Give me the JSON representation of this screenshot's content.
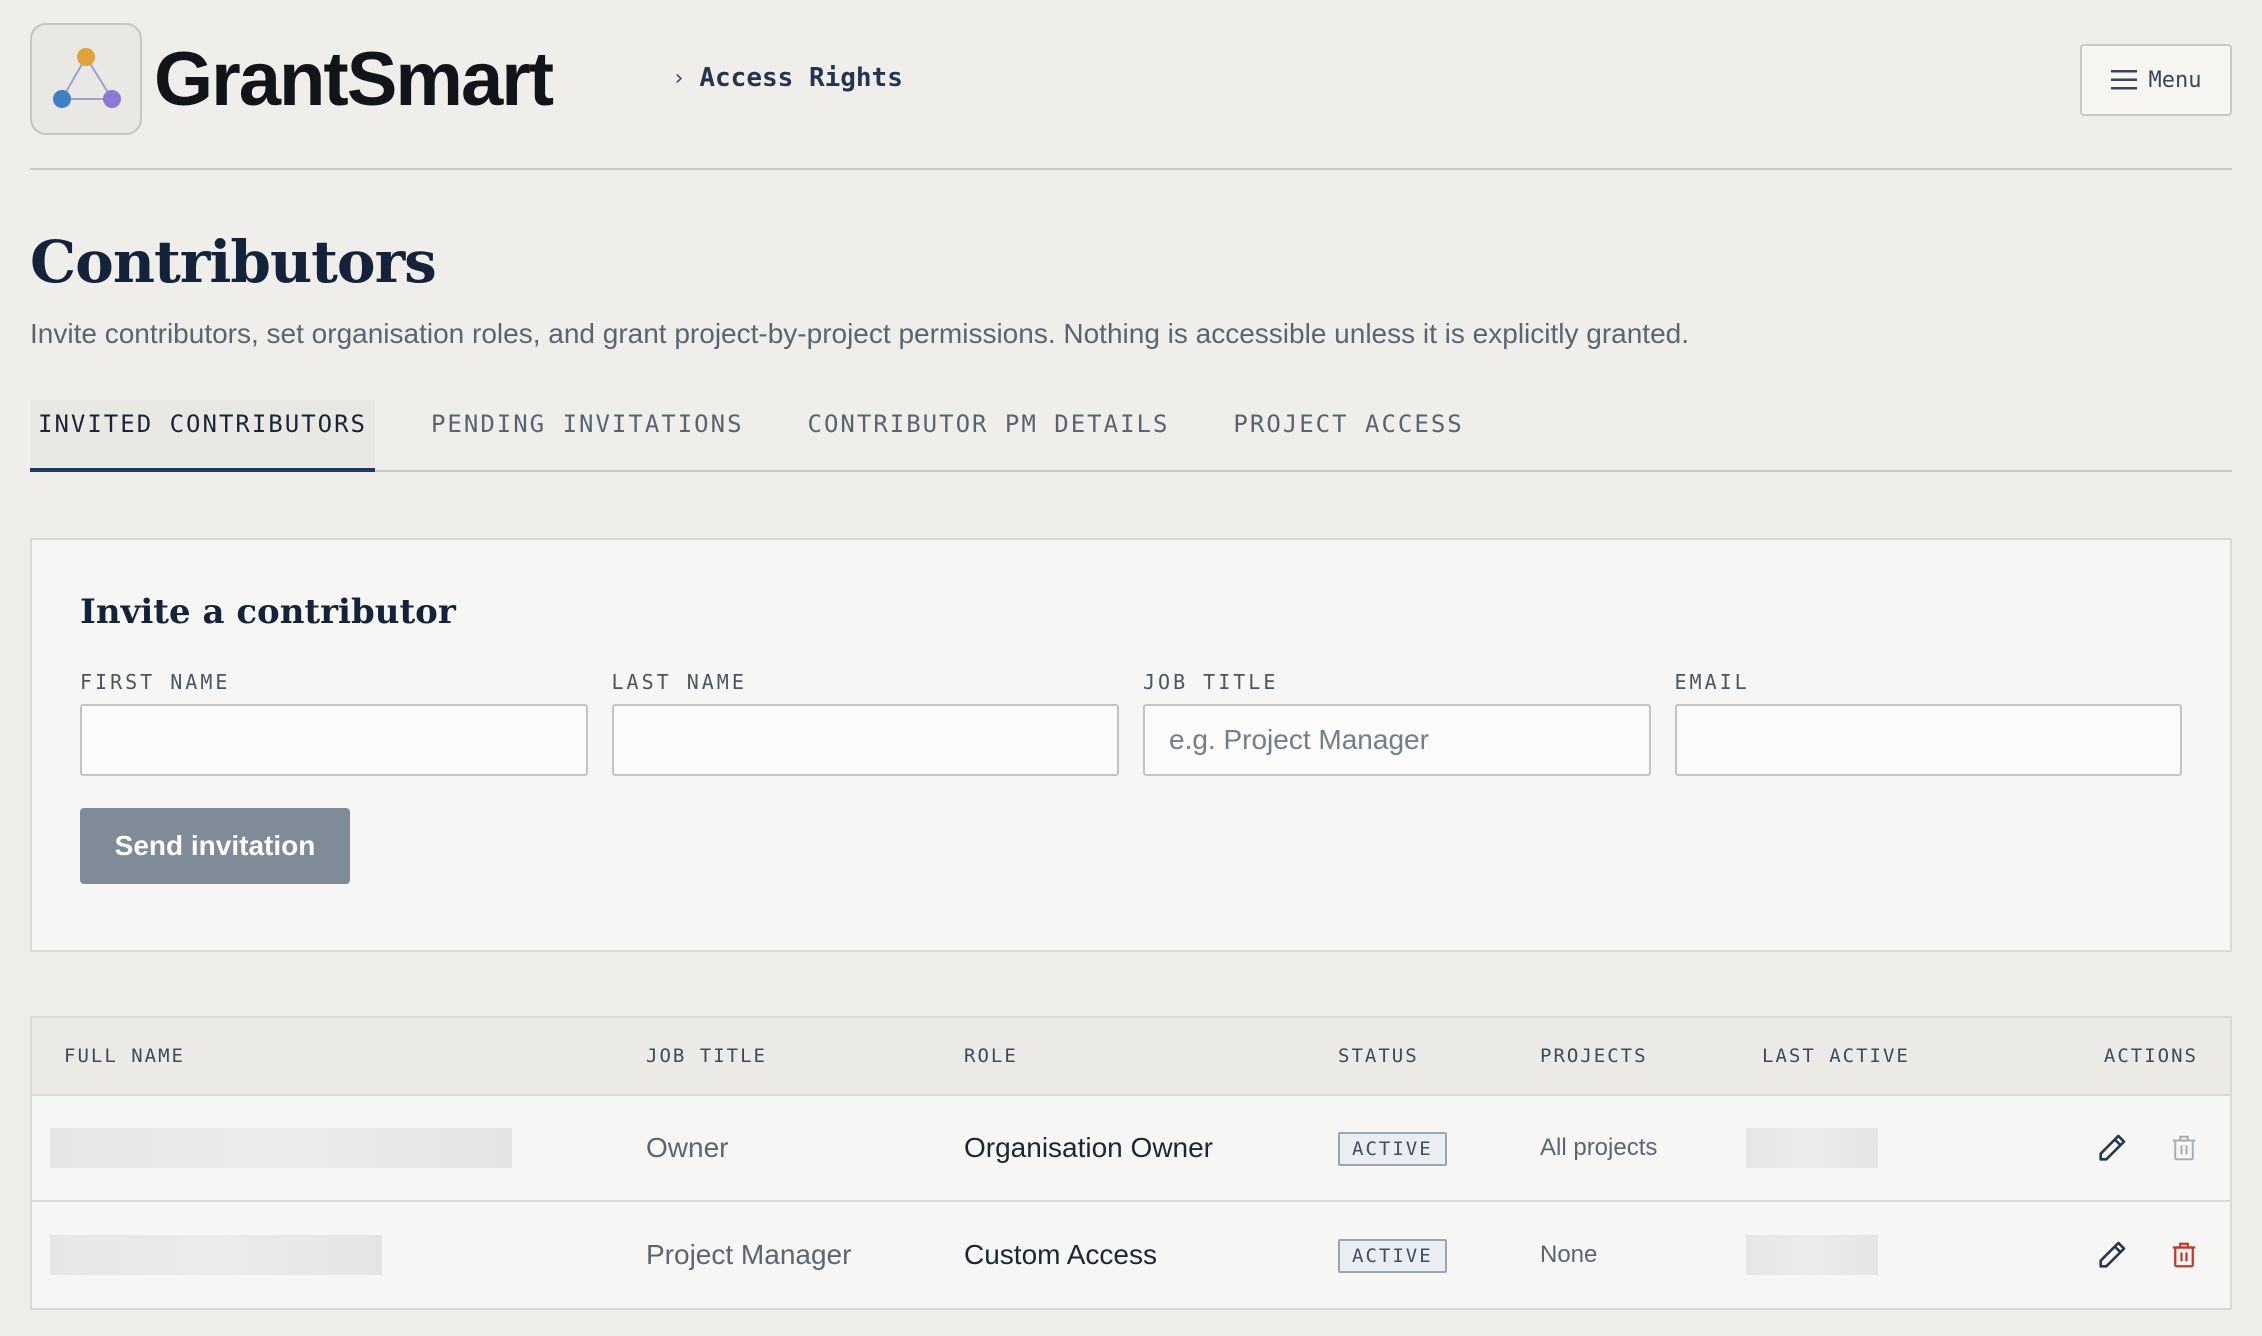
{
  "app": {
    "brand": "GrantSmart",
    "breadcrumb": "Access Rights",
    "menu_label": "Menu"
  },
  "page": {
    "title": "Contributors",
    "subtitle": "Invite contributors, set organisation roles, and grant project-by-project permissions. Nothing is accessible unless it is explicitly granted."
  },
  "tabs": [
    {
      "label": "INVITED CONTRIBUTORS",
      "active": true
    },
    {
      "label": "PENDING INVITATIONS",
      "active": false
    },
    {
      "label": "CONTRIBUTOR PM DETAILS",
      "active": false
    },
    {
      "label": "PROJECT ACCESS",
      "active": false
    }
  ],
  "invite": {
    "title": "Invite a contributor",
    "fields": [
      {
        "label": "FIRST NAME",
        "value": "",
        "placeholder": ""
      },
      {
        "label": "LAST NAME",
        "value": "",
        "placeholder": ""
      },
      {
        "label": "JOB TITLE",
        "value": "",
        "placeholder": "e.g. Project Manager"
      },
      {
        "label": "EMAIL",
        "value": "",
        "placeholder": ""
      }
    ],
    "submit_label": "Send invitation"
  },
  "table": {
    "columns": [
      "FULL NAME",
      "JOB TITLE",
      "ROLE",
      "STATUS",
      "PROJECTS",
      "LAST ACTIVE",
      "ACTIONS"
    ],
    "rows": [
      {
        "job_title": "Owner",
        "role": "Organisation Owner",
        "status": "ACTIVE",
        "projects": "All projects",
        "delete_enabled": false
      },
      {
        "job_title": "Project Manager",
        "role": "Custom Access",
        "status": "ACTIVE",
        "projects": "None",
        "delete_enabled": true
      }
    ]
  },
  "colors": {
    "accent": "#1f3a5c",
    "button_disabled": "#7f8b96",
    "danger": "#c0392b",
    "logo_orange": "#e0a23a",
    "logo_blue": "#3f7fc4",
    "logo_purple": "#8b79d6"
  },
  "icons": {
    "logo": "triangle-nodes-icon",
    "menu": "hamburger-icon",
    "edit": "pencil-icon",
    "delete": "trash-icon"
  }
}
